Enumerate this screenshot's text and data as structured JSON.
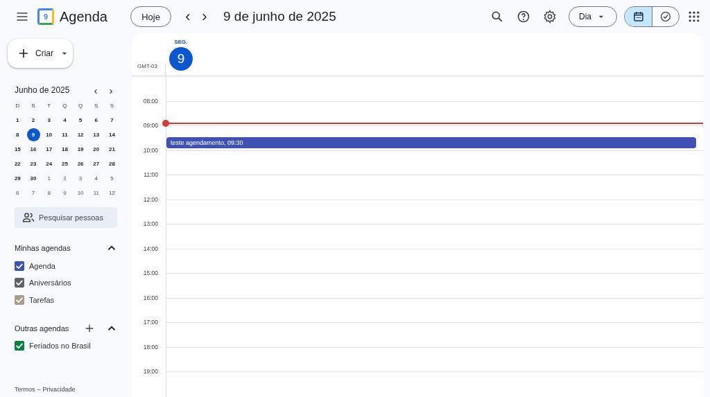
{
  "app": {
    "name": "Agenda",
    "logo_text": "9"
  },
  "toolbar": {
    "today": "Hoje",
    "prev": "‹",
    "next": "›",
    "title": "9 de junho de 2025",
    "view": "Dia",
    "modes": [
      {
        "kind": "calendar",
        "selected": true
      },
      {
        "kind": "tasks",
        "selected": false
      }
    ]
  },
  "create": {
    "label": "Criar"
  },
  "mini_calendar": {
    "title": "Junho de 2025",
    "weekdays": [
      "D",
      "S",
      "T",
      "Q",
      "Q",
      "S",
      "S"
    ],
    "weeks": [
      [
        {
          "day": "1",
          "outside": false,
          "selected": false
        },
        {
          "day": "2",
          "outside": false,
          "selected": false
        },
        {
          "day": "3",
          "outside": false,
          "selected": false
        },
        {
          "day": "4",
          "outside": false,
          "selected": false
        },
        {
          "day": "5",
          "outside": false,
          "selected": false
        },
        {
          "day": "6",
          "outside": false,
          "selected": false
        },
        {
          "day": "7",
          "outside": false,
          "selected": false
        }
      ],
      [
        {
          "day": "8",
          "outside": false,
          "selected": false
        },
        {
          "day": "9",
          "outside": false,
          "selected": true
        },
        {
          "day": "10",
          "outside": false,
          "selected": false
        },
        {
          "day": "11",
          "outside": false,
          "selected": false
        },
        {
          "day": "12",
          "outside": false,
          "selected": false
        },
        {
          "day": "13",
          "outside": false,
          "selected": false
        },
        {
          "day": "14",
          "outside": false,
          "selected": false
        }
      ],
      [
        {
          "day": "15",
          "outside": false,
          "selected": false
        },
        {
          "day": "16",
          "outside": false,
          "selected": false
        },
        {
          "day": "17",
          "outside": false,
          "selected": false
        },
        {
          "day": "18",
          "outside": false,
          "selected": false
        },
        {
          "day": "19",
          "outside": false,
          "selected": false
        },
        {
          "day": "20",
          "outside": false,
          "selected": false
        },
        {
          "day": "21",
          "outside": false,
          "selected": false
        }
      ],
      [
        {
          "day": "22",
          "outside": false,
          "selected": false
        },
        {
          "day": "23",
          "outside": false,
          "selected": false
        },
        {
          "day": "24",
          "outside": false,
          "selected": false
        },
        {
          "day": "25",
          "outside": false,
          "selected": false
        },
        {
          "day": "26",
          "outside": false,
          "selected": false
        },
        {
          "day": "27",
          "outside": false,
          "selected": false
        },
        {
          "day": "28",
          "outside": false,
          "selected": false
        }
      ],
      [
        {
          "day": "29",
          "outside": false,
          "selected": false
        },
        {
          "day": "30",
          "outside": false,
          "selected": false
        },
        {
          "day": "1",
          "outside": true,
          "selected": false
        },
        {
          "day": "2",
          "outside": true,
          "selected": false
        },
        {
          "day": "3",
          "outside": true,
          "selected": false
        },
        {
          "day": "4",
          "outside": true,
          "selected": false
        },
        {
          "day": "5",
          "outside": true,
          "selected": false
        }
      ],
      [
        {
          "day": "6",
          "outside": true,
          "selected": false
        },
        {
          "day": "7",
          "outside": true,
          "selected": false
        },
        {
          "day": "8",
          "outside": true,
          "selected": false
        },
        {
          "day": "9",
          "outside": true,
          "selected": false
        },
        {
          "day": "10",
          "outside": true,
          "selected": false
        },
        {
          "day": "11",
          "outside": true,
          "selected": false
        },
        {
          "day": "12",
          "outside": true,
          "selected": false
        }
      ]
    ]
  },
  "search_people": {
    "placeholder": "Pesquisar pessoas"
  },
  "calendar_groups": [
    {
      "title": "Minhas agendas",
      "expanded": true,
      "can_add": false,
      "items": [
        {
          "name": "Agenda",
          "checked": true,
          "color": "#3f51b5"
        },
        {
          "name": "Aniversários",
          "checked": true,
          "color": "#616161"
        },
        {
          "name": "Tarefas",
          "checked": true,
          "color": "#a79b8e"
        }
      ]
    },
    {
      "title": "Outras agendas",
      "expanded": true,
      "can_add": true,
      "items": [
        {
          "name": "Feriados no Brasil",
          "checked": true,
          "color": "#0b8043"
        }
      ]
    }
  ],
  "footer": {
    "terms": "Termos",
    "separator": "–",
    "privacy": "Privacidade"
  },
  "day_view": {
    "weekday": "SEG.",
    "day": "9",
    "today": true,
    "timezone": "GMT-03",
    "hours": [
      "08:00",
      "09:00",
      "10:00",
      "11:00",
      "12:00",
      "13:00",
      "14:00",
      "15:00",
      "16:00",
      "17:00",
      "18:00",
      "19:00"
    ],
    "events": [
      {
        "title": "teste agendamento, 09:30",
        "color": "#3f51b5"
      }
    ]
  }
}
